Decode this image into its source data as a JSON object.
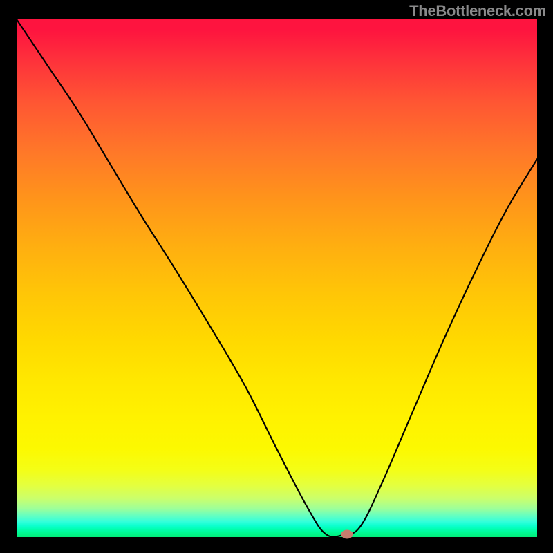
{
  "watermark": "TheBottleneck.com",
  "chart_data": {
    "type": "line",
    "title": "",
    "xlabel": "",
    "ylabel": "",
    "xlim": [
      0,
      100
    ],
    "ylim": [
      0,
      100
    ],
    "grid": false,
    "legend": false,
    "series": [
      {
        "name": "bottleneck-curve",
        "color": "#000000",
        "x": [
          0,
          6,
          12,
          18,
          24,
          30,
          37,
          44,
          50,
          56,
          59.5,
          63,
          66,
          70,
          76,
          82,
          88,
          94,
          100
        ],
        "y": [
          100,
          91,
          82,
          72,
          62,
          52.5,
          41,
          29,
          17,
          5.5,
          0.5,
          0.5,
          2,
          10,
          24,
          38,
          51,
          63,
          73
        ]
      }
    ],
    "marker": {
      "x": 63.5,
      "y": 0.5,
      "color": "#c97d6f"
    },
    "background_gradient": {
      "direction": "vertical",
      "stops": [
        {
          "pos": 0,
          "color": "#fe143f"
        },
        {
          "pos": 50,
          "color": "#ffd200"
        },
        {
          "pos": 85,
          "color": "#f6ff10"
        },
        {
          "pos": 100,
          "color": "#02ec7a"
        }
      ]
    }
  }
}
